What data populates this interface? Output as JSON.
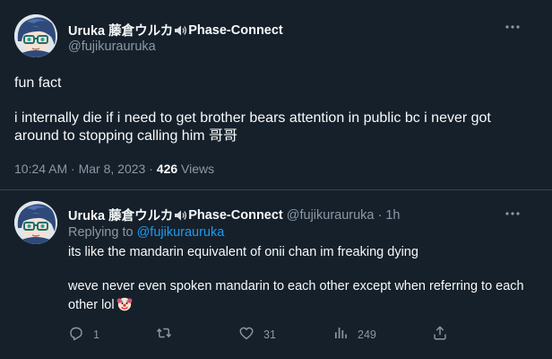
{
  "main_tweet": {
    "display_name": "Uruka 藤倉ウルカ",
    "display_name_suffix": "Phase-Connect",
    "handle": "@fujikurauruka",
    "text": "fun fact\n\ni internally die if i need to get brother bears attention in public bc i never got around to stopping calling him 哥哥",
    "time": "10:24 AM",
    "separator": " · ",
    "date": "Mar 8, 2023",
    "views_count": "426",
    "views_label": " Views"
  },
  "reply_tweet": {
    "display_name": "Uruka 藤倉ウルカ",
    "display_name_suffix": "Phase-Connect",
    "handle": "@fujikurauruka",
    "separator": " · ",
    "time_ago": "1h",
    "replying_label": "Replying to ",
    "replying_to": "@fujikurauruka",
    "text": "its like the mandarin equivalent of onii chan im freaking dying\n\nweve never even spoken mandarin to each other except when referring to each other lol",
    "actions": {
      "reply_count": "1",
      "retweet_count": "",
      "like_count": "31",
      "views_count": "249"
    }
  },
  "icons": {
    "avatar": "avatar-image",
    "speaker": "speaker-icon",
    "more": "more-icon",
    "reply": "reply-icon",
    "retweet": "retweet-icon",
    "like": "heart-icon",
    "views": "views-icon",
    "share": "share-icon",
    "emoji": "clown-emoji"
  },
  "colors": {
    "background": "#15202b",
    "text": "#f7f9f9",
    "muted": "#8b98a5",
    "link": "#1d9bf0",
    "divider": "#38444d"
  }
}
